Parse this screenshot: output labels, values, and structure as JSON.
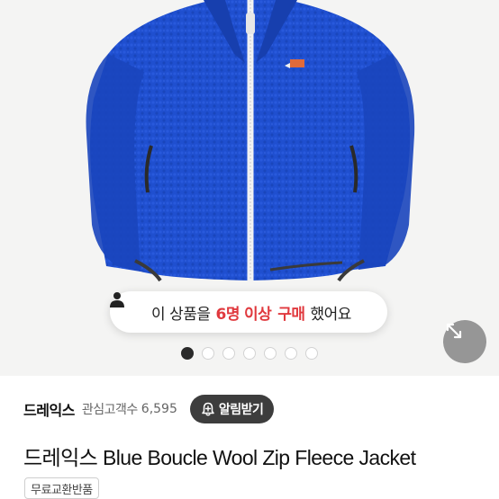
{
  "product": {
    "image_alt": "Blue boucle fleece zip jacket",
    "social_proof": {
      "prefix": "이 상품을",
      "count": "6명",
      "middle": "이상",
      "action": "구매",
      "suffix": "했어요"
    },
    "gallery": {
      "total": 7,
      "active": 0
    },
    "store": {
      "name": "드레익스",
      "favorites_label": "관심고객수",
      "favorites_count": "6,595",
      "alarm_button": "알림받기"
    },
    "title": "드레익스 Blue Boucle Wool Zip Fleece Jacket",
    "badge": "무료교환반품"
  },
  "colors": {
    "jacket": "#1f4fcf",
    "highlight": "#e0393e",
    "button": "#3d3d3d"
  },
  "icons": {
    "person": "person-icon",
    "expand": "expand-icon",
    "bell": "bell-plus-icon"
  }
}
